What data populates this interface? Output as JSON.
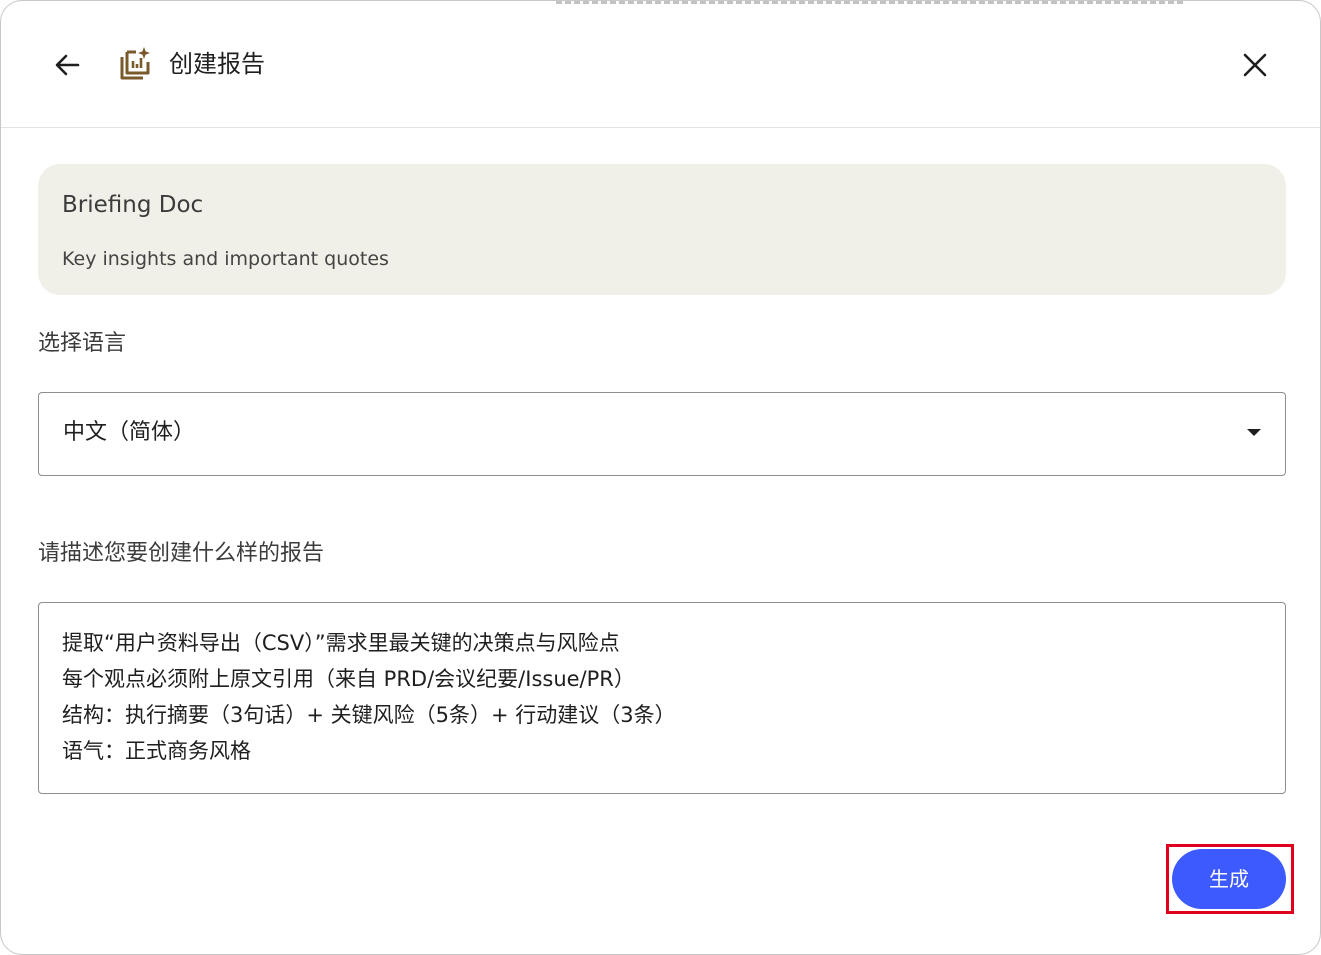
{
  "header": {
    "title": "创建报告",
    "back_icon": "arrow-back-icon",
    "report_icon": "report-sparkle-icon",
    "close_icon": "close-icon"
  },
  "format_card": {
    "title": "Briefing Doc",
    "subtitle": "Key insights and important quotes"
  },
  "language": {
    "label": "选择语言",
    "selected": "中文（简体）"
  },
  "description": {
    "label": "请描述您要创建什么样的报告",
    "lines": [
      "提取“用户资料导出（CSV）”需求里最关键的决策点与风险点",
      "每个观点必须附上原文引用（来自 PRD/会议纪要/Issue/PR）",
      "结构：执行摘要（3句话）+ 关键风险（5条）+ 行动建议（3条）",
      "语气：正式商务风格"
    ]
  },
  "actions": {
    "generate_label": "生成"
  },
  "colors": {
    "accent": "#3d5afe",
    "card_bg": "#f1f0e8",
    "icon_brown": "#7a5a2b",
    "highlight": "#e0001b"
  }
}
